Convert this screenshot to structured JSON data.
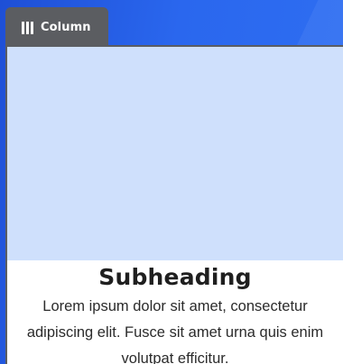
{
  "tab": {
    "icon": "column-icon",
    "label": "Column"
  },
  "card": {
    "image_color": "#cfe0fc",
    "subheading": "Subheading",
    "body": "Lorem ipsum dolor sit amet, consectetur adipiscing elit. Fusce sit amet urna quis enim volutpat efficitur."
  },
  "colors": {
    "background": "#2563eb",
    "tab": "#5b5d61",
    "card_border": "#5b5d61"
  }
}
